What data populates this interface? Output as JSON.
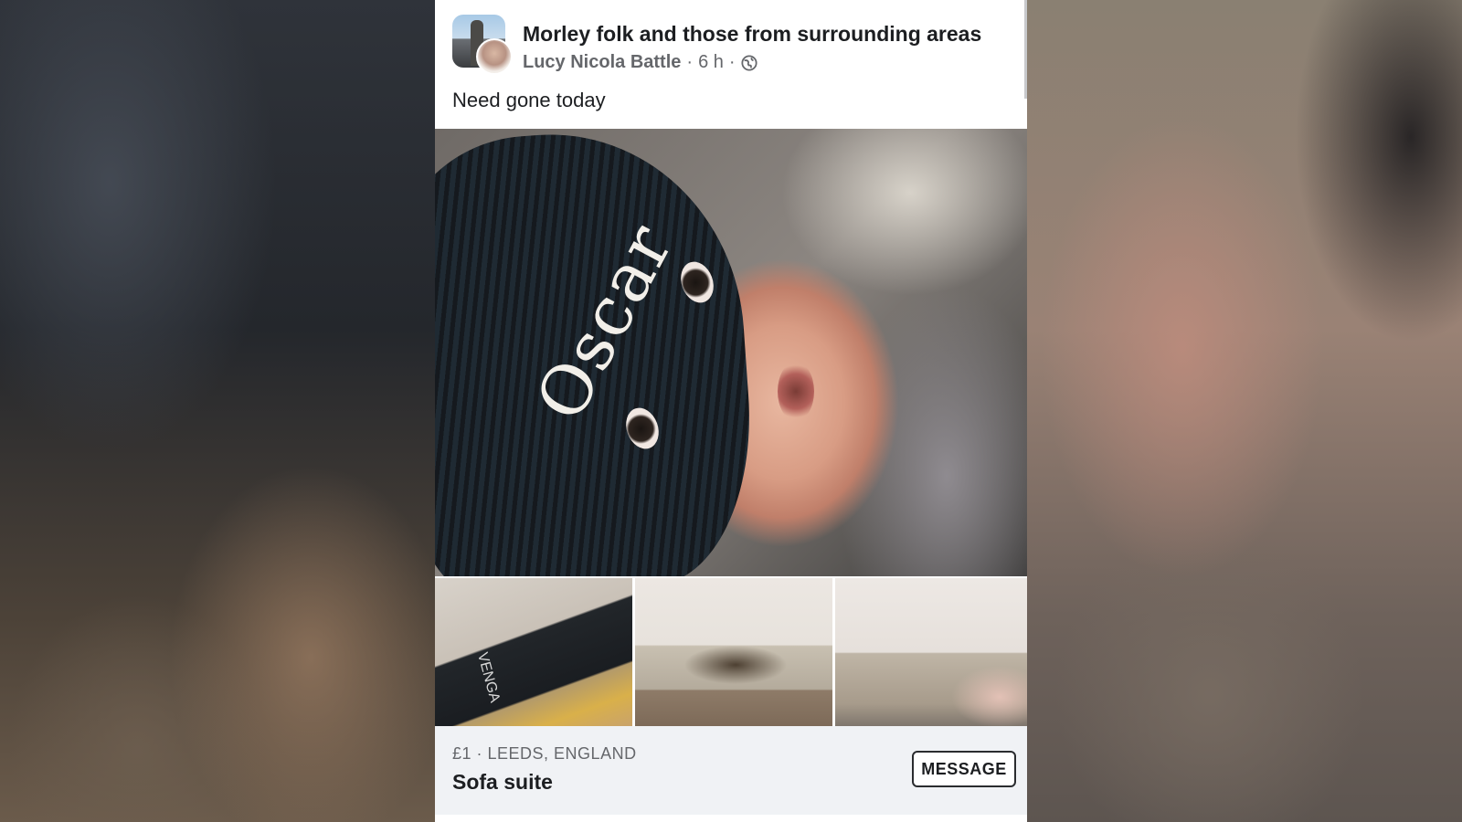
{
  "post": {
    "group_name": "Morley folk and those from surrounding areas",
    "author": "Lucy Nicola Battle",
    "time": "6 h",
    "separator": "·",
    "body": "Need gone today"
  },
  "photo": {
    "hat_text": "Oscar"
  },
  "listing": {
    "price_location": "£1 · LEEDS, ENGLAND",
    "title": "Sofa suite",
    "message_label": "MESSAGE"
  }
}
